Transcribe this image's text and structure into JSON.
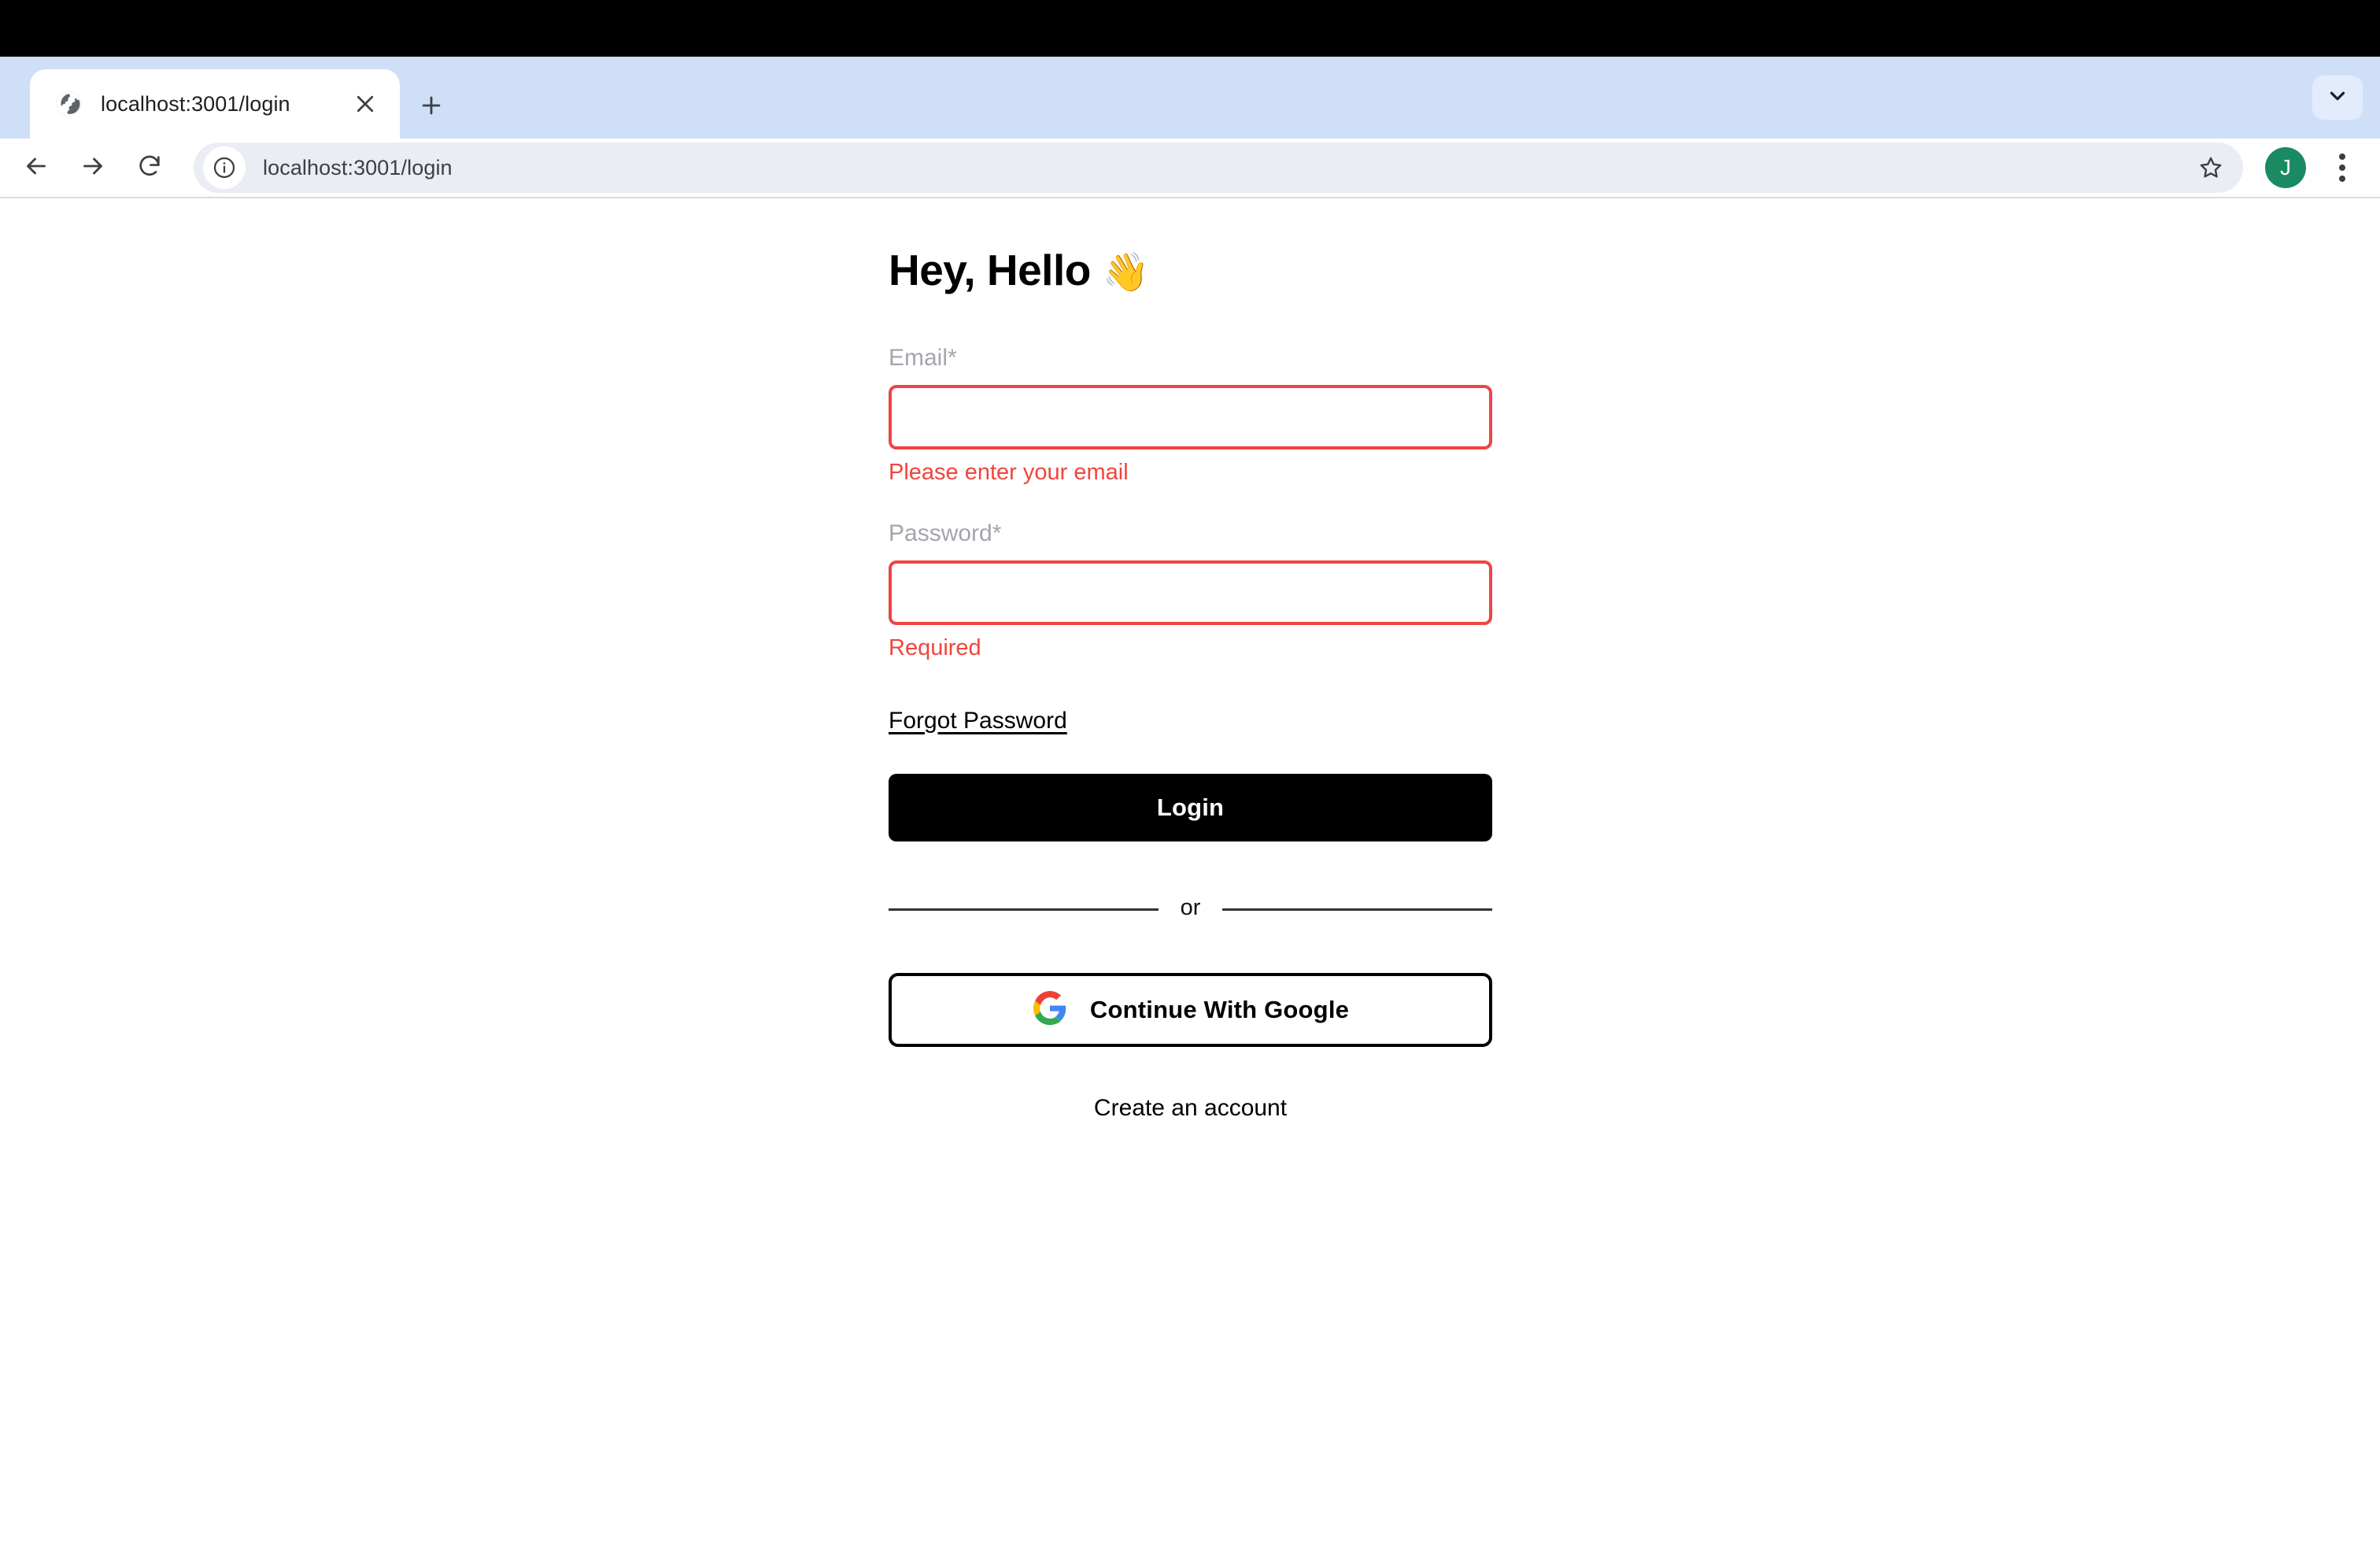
{
  "browser": {
    "tab": {
      "title": "localhost:3001/login",
      "favicon": "globe-icon",
      "close_icon": "close-icon"
    },
    "new_tab_icon": "plus-icon",
    "tab_search_icon": "chevron-down-icon",
    "toolbar": {
      "back_icon": "arrow-left-icon",
      "forward_icon": "arrow-right-icon",
      "reload_icon": "reload-icon",
      "info_icon": "info-circle-icon",
      "url": "localhost:3001/login",
      "bookmark_icon": "star-icon",
      "profile_initial": "J",
      "profile_color": "#1a8a62",
      "menu_icon": "kebab-menu-icon"
    }
  },
  "page": {
    "heading": "Hey, Hello",
    "heading_emoji": "👋",
    "email": {
      "label": "Email*",
      "value": "",
      "placeholder": "",
      "error": "Please enter your email"
    },
    "password": {
      "label": "Password*",
      "value": "",
      "placeholder": "",
      "error": "Required"
    },
    "forgot_password_label": "Forgot Password",
    "login_button_label": "Login",
    "divider_label": "or",
    "google_button_label": "Continue With Google",
    "google_icon": "google-g-icon",
    "create_account_label": "Create an account",
    "colors": {
      "error": "#f0453c",
      "primary": "#000000",
      "label": "#a4a4ad",
      "divider": "#2f3437"
    }
  }
}
